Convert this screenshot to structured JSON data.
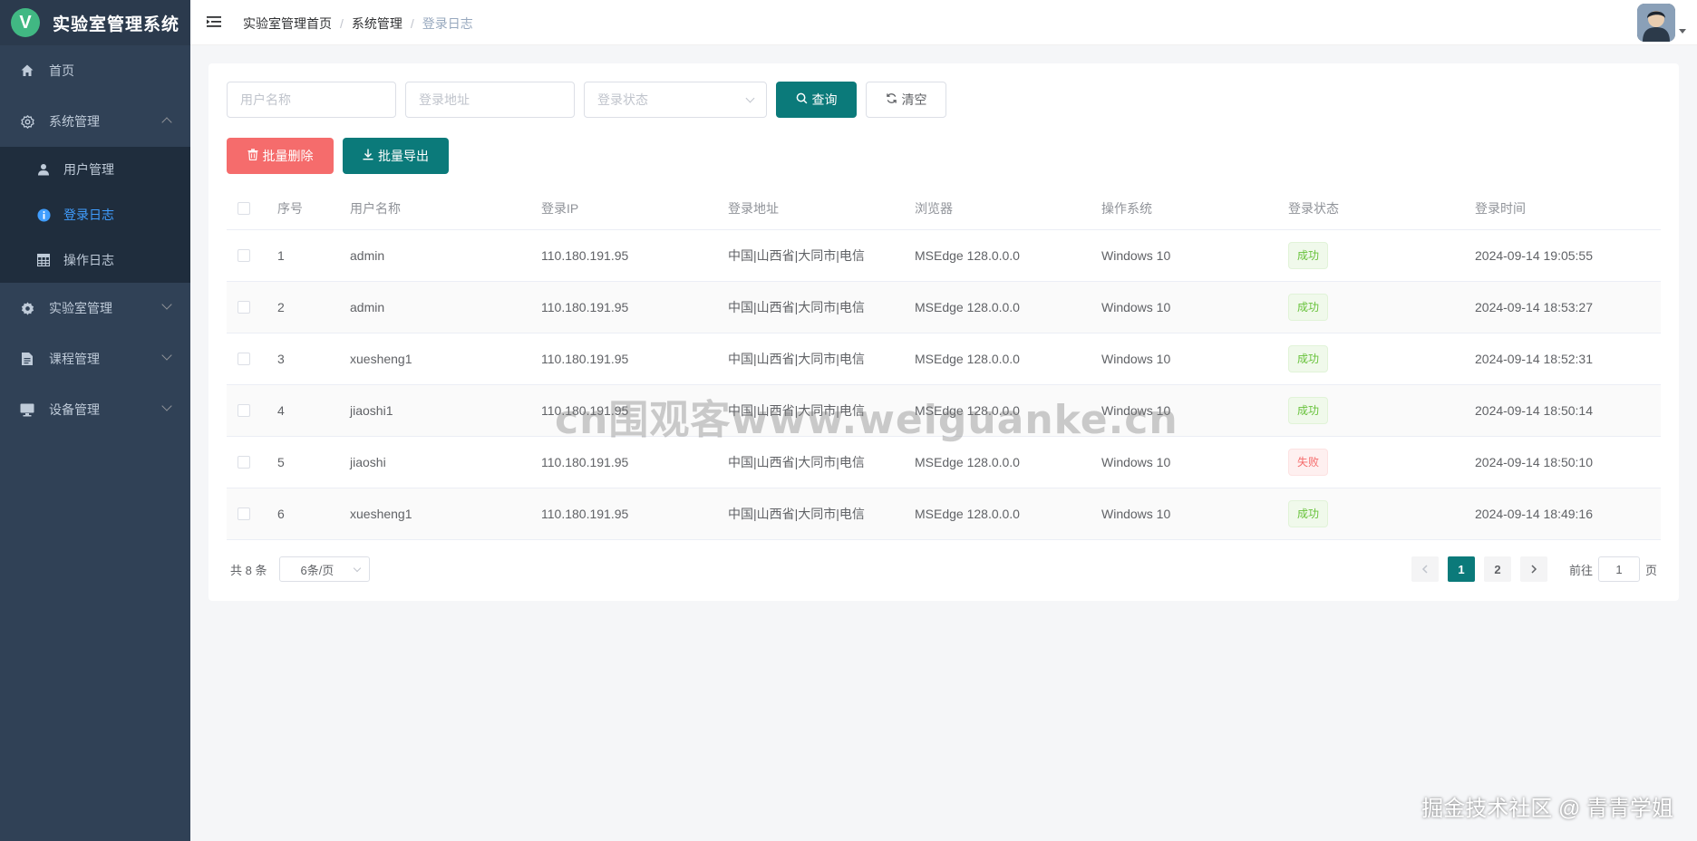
{
  "app": {
    "logo_letter": "V",
    "title": "实验室管理系统"
  },
  "sidebar": {
    "items": [
      {
        "label": "首页",
        "icon": "home-icon"
      },
      {
        "label": "系统管理",
        "icon": "gear-icon",
        "expanded": true,
        "children": [
          {
            "label": "用户管理",
            "icon": "user-icon"
          },
          {
            "label": "登录日志",
            "icon": "info-circle-icon",
            "active": true
          },
          {
            "label": "操作日志",
            "icon": "table-grid-icon"
          }
        ]
      },
      {
        "label": "实验室管理",
        "icon": "cog-icon"
      },
      {
        "label": "课程管理",
        "icon": "document-icon"
      },
      {
        "label": "设备管理",
        "icon": "monitor-icon"
      }
    ]
  },
  "breadcrumb": [
    "实验室管理首页",
    "系统管理",
    "登录日志"
  ],
  "search": {
    "username_placeholder": "用户名称",
    "address_placeholder": "登录地址",
    "status_placeholder": "登录状态",
    "query_label": "查询",
    "clear_label": "清空"
  },
  "toolbar": {
    "batch_delete_label": "批量删除",
    "batch_export_label": "批量导出"
  },
  "table": {
    "columns": [
      "序号",
      "用户名称",
      "登录IP",
      "登录地址",
      "浏览器",
      "操作系统",
      "登录状态",
      "登录时间"
    ],
    "rows": [
      {
        "idx": "1",
        "user": "admin",
        "ip": "110.180.191.95",
        "addr": "中国|山西省|大同市|电信",
        "browser": "MSEdge 128.0.0.0",
        "os": "Windows 10",
        "status": "成功",
        "time": "2024-09-14 19:05:55"
      },
      {
        "idx": "2",
        "user": "admin",
        "ip": "110.180.191.95",
        "addr": "中国|山西省|大同市|电信",
        "browser": "MSEdge 128.0.0.0",
        "os": "Windows 10",
        "status": "成功",
        "time": "2024-09-14 18:53:27"
      },
      {
        "idx": "3",
        "user": "xuesheng1",
        "ip": "110.180.191.95",
        "addr": "中国|山西省|大同市|电信",
        "browser": "MSEdge 128.0.0.0",
        "os": "Windows 10",
        "status": "成功",
        "time": "2024-09-14 18:52:31"
      },
      {
        "idx": "4",
        "user": "jiaoshi1",
        "ip": "110.180.191.95",
        "addr": "中国|山西省|大同市|电信",
        "browser": "MSEdge 128.0.0.0",
        "os": "Windows 10",
        "status": "成功",
        "time": "2024-09-14 18:50:14"
      },
      {
        "idx": "5",
        "user": "jiaoshi",
        "ip": "110.180.191.95",
        "addr": "中国|山西省|大同市|电信",
        "browser": "MSEdge 128.0.0.0",
        "os": "Windows 10",
        "status": "失败",
        "time": "2024-09-14 18:50:10"
      },
      {
        "idx": "6",
        "user": "xuesheng1",
        "ip": "110.180.191.95",
        "addr": "中国|山西省|大同市|电信",
        "browser": "MSEdge 128.0.0.0",
        "os": "Windows 10",
        "status": "成功",
        "time": "2024-09-14 18:49:16"
      }
    ]
  },
  "pagination": {
    "total_label": "共 8 条",
    "page_size_label": "6条/页",
    "pages": [
      "1",
      "2"
    ],
    "current_page": "1",
    "goto_prefix": "前往",
    "goto_value": "1",
    "goto_suffix": "页"
  },
  "watermarks": {
    "center": "cn围观客www.weiguanke.cn",
    "corner": "掘金技术社区 @ 青青学姐"
  },
  "colors": {
    "sidebar_bg": "#304156",
    "primary": "#0b7a7a",
    "danger": "#f56c6c",
    "active_link": "#409eff",
    "success": "#67c23a"
  }
}
